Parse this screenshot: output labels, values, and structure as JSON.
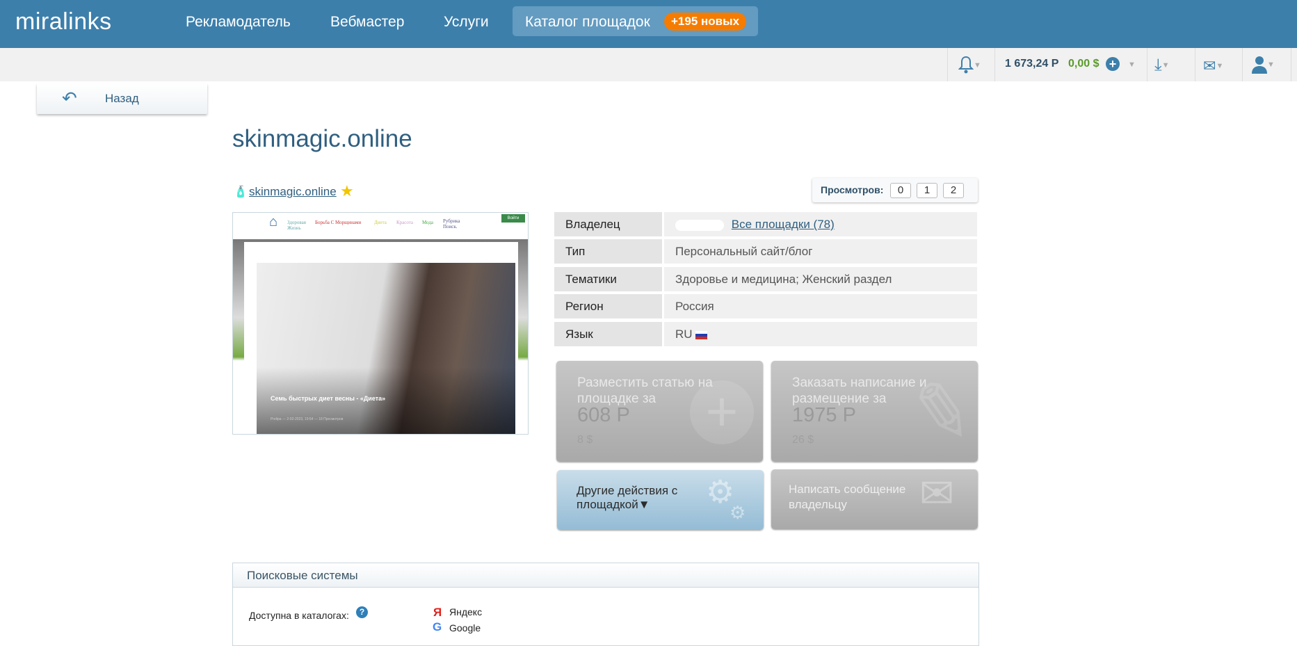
{
  "header": {
    "logo": "miralinks",
    "nav": [
      "Рекламодатель",
      "Вебмастер",
      "Услуги"
    ],
    "active_tab": "Каталог площадок",
    "badge": "+195 новых"
  },
  "toolbar": {
    "balance_rub": "1 673,24 Р",
    "balance_usd": "0,00 $"
  },
  "back_label": "Назад",
  "title": "skinmagic.online",
  "site_link": "skinmagic.online",
  "thumbnail": {
    "nav": [
      "Здоровая Жизнь",
      "Борьба С Морщинами",
      "Диета",
      "Красота",
      "Мода",
      "Рубрика Поиск."
    ],
    "login": "Войти",
    "headline": "Семь быстрых диет весны - «Диета»",
    "meta": "Prelipa — 2-02-2023, 19:54 — 18 Просмотров"
  },
  "views": {
    "label": "Просмотров:",
    "values": [
      "0",
      "1",
      "2"
    ]
  },
  "info": [
    {
      "label": "Владелец",
      "value": "Все площадки (78)"
    },
    {
      "label": "Тип",
      "value": "Персональный сайт/блог"
    },
    {
      "label": "Тематики",
      "value": "Здоровье и медицина; Женский раздел"
    },
    {
      "label": "Регион",
      "value": "Россия"
    },
    {
      "label": "Язык",
      "value": "RU"
    }
  ],
  "actions": {
    "place": {
      "title": "Разместить статью на площадке за",
      "price": "608 Р",
      "usd": "8 $"
    },
    "order": {
      "title": "Заказать написание и размещение за",
      "price": "1975 Р",
      "usd": "26 $"
    },
    "other": "Другие действия с площадкой▼",
    "message": "Написать сообщение владельцу"
  },
  "search": {
    "title": "Поисковые системы",
    "label": "Доступна в каталогах:",
    "engines": [
      "Яндекс",
      "Google"
    ]
  }
}
